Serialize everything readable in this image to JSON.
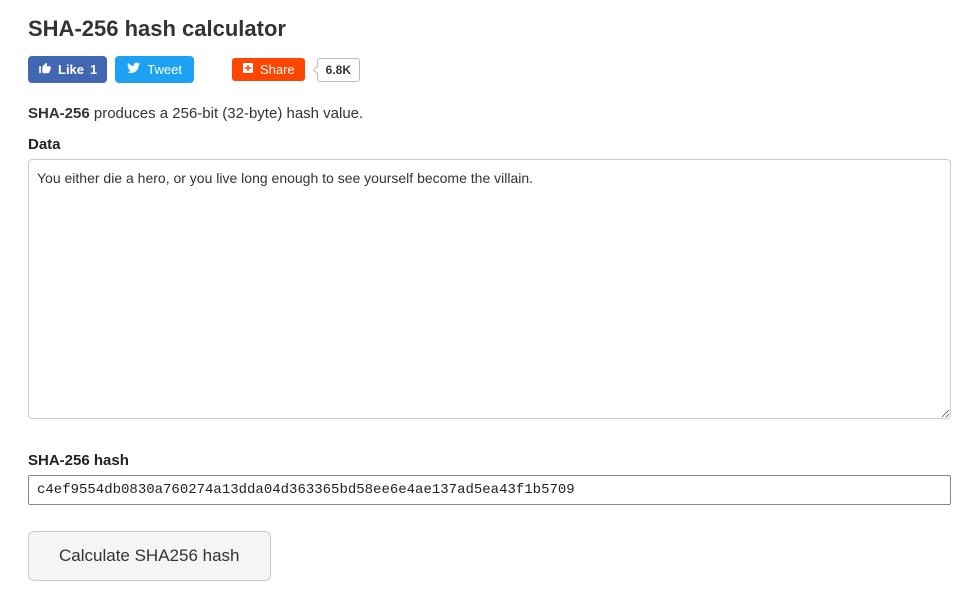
{
  "page": {
    "title": "SHA-256 hash calculator",
    "description_bold": "SHA-256",
    "description_rest": " produces a 256-bit (32-byte) hash value."
  },
  "social": {
    "like_label": "Like",
    "like_count": "1",
    "tweet_label": "Tweet",
    "share_label": "Share",
    "share_count": "6.8K"
  },
  "form": {
    "data_label": "Data",
    "data_value": "You either die a hero, or you live long enough to see yourself become the villain.",
    "hash_label": "SHA-256 hash",
    "hash_value": "c4ef9554db0830a760274a13dda04d363365bd58ee6e4ae137ad5ea43f1b5709",
    "calc_button": "Calculate SHA256 hash"
  }
}
